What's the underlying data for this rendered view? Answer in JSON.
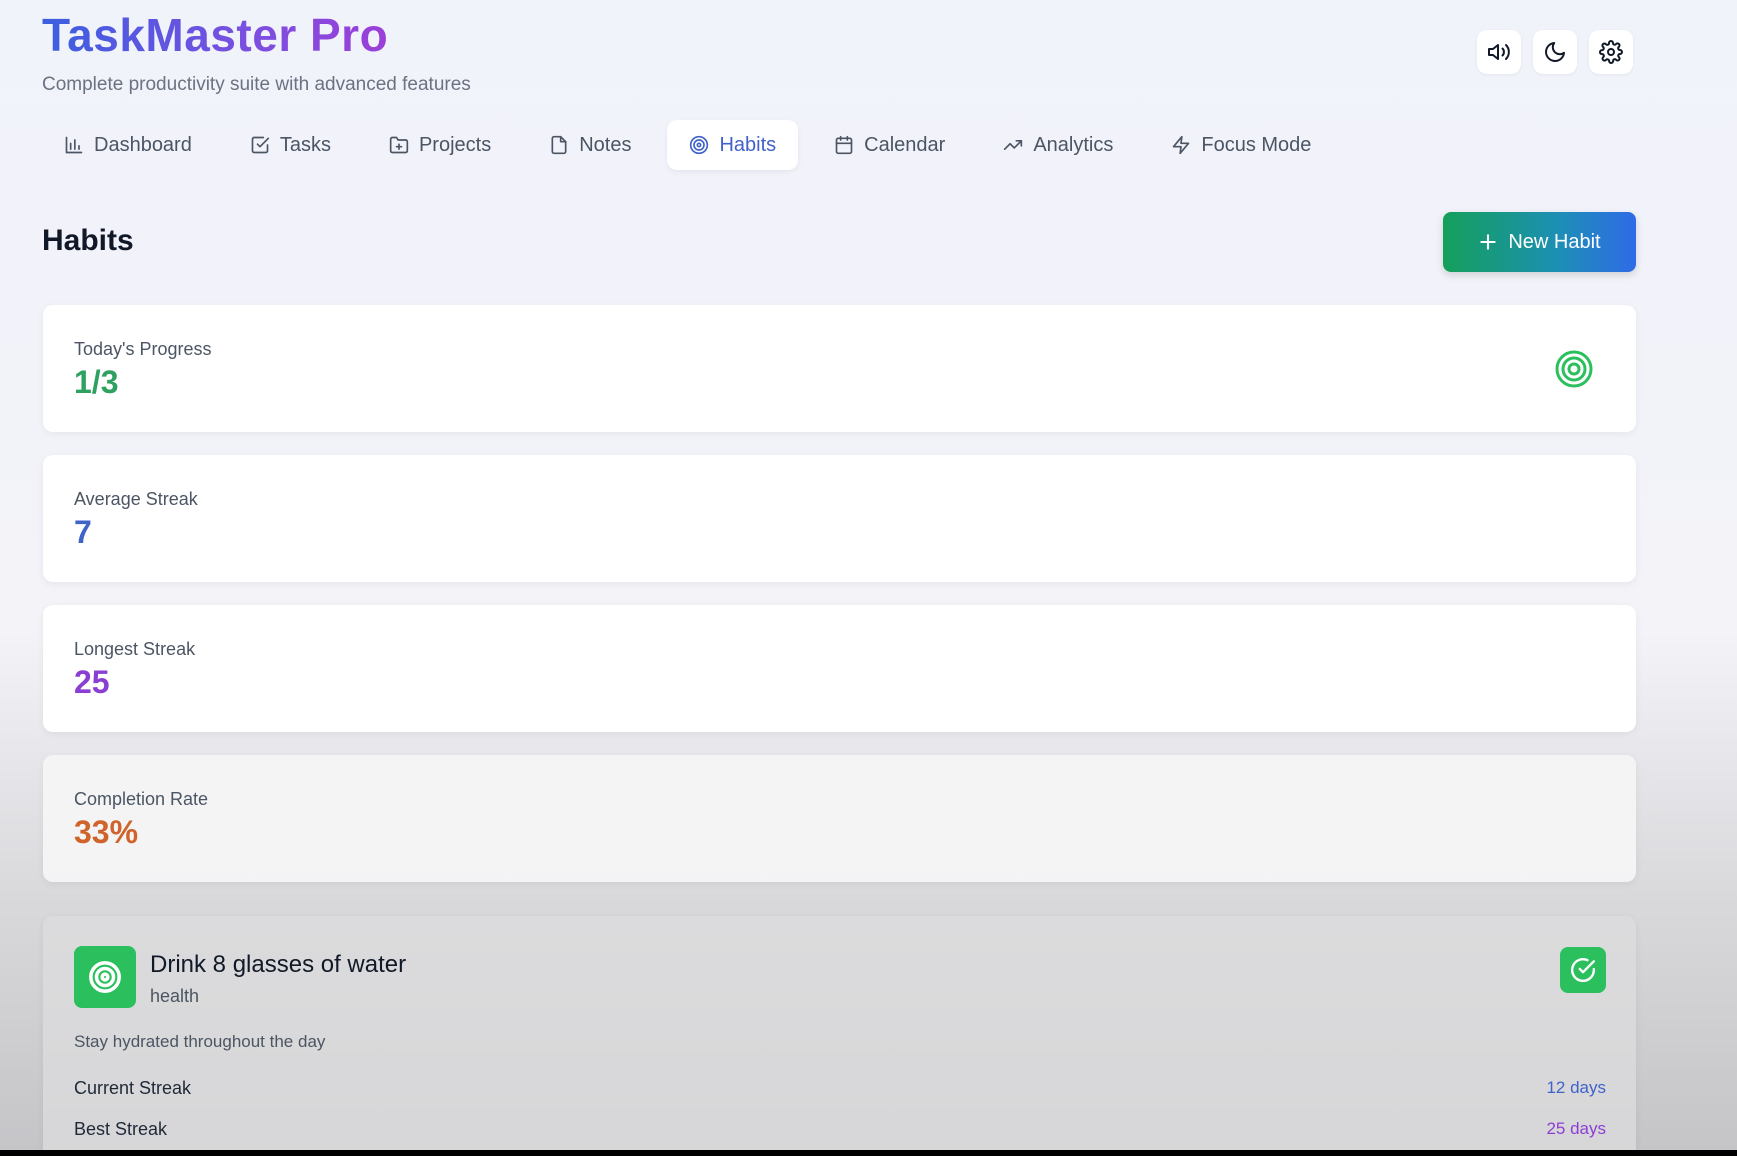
{
  "app": {
    "title": "TaskMaster Pro",
    "subtitle": "Complete productivity suite with advanced features"
  },
  "top_actions": [
    {
      "name": "sound-toggle-button",
      "icon": "volume-icon"
    },
    {
      "name": "dark-mode-button",
      "icon": "moon-icon"
    },
    {
      "name": "settings-button",
      "icon": "gear-icon"
    }
  ],
  "nav": {
    "items": [
      {
        "label": "Dashboard",
        "icon": "bar-chart-icon"
      },
      {
        "label": "Tasks",
        "icon": "checkbox-icon"
      },
      {
        "label": "Projects",
        "icon": "folder-icon"
      },
      {
        "label": "Notes",
        "icon": "file-icon"
      },
      {
        "label": "Habits",
        "icon": "target-icon",
        "active": true
      },
      {
        "label": "Calendar",
        "icon": "calendar-icon"
      },
      {
        "label": "Analytics",
        "icon": "trending-up-icon"
      },
      {
        "label": "Focus Mode",
        "icon": "lightning-icon"
      }
    ]
  },
  "page": {
    "title": "Habits",
    "new_button_label": "New Habit"
  },
  "stats": [
    {
      "label": "Today's Progress",
      "value": "1/3",
      "color": "#2ea160"
    },
    {
      "label": "Average Streak",
      "value": "7",
      "color": "#3f63c9"
    },
    {
      "label": "Longest Streak",
      "value": "25",
      "color": "#8b3fd2"
    },
    {
      "label": "Completion Rate",
      "value": "33%",
      "color": "#d0632a"
    }
  ],
  "habit": {
    "name": "Drink 8 glasses of water",
    "category": "health",
    "description": "Stay hydrated throughout the day",
    "current_streak_label": "Current Streak",
    "current_streak_value": "12 days",
    "best_streak_label": "Best Streak",
    "best_streak_value": "25 days",
    "accent": "#2bbf5e"
  },
  "colors": {
    "accent_blue": "#4262c9",
    "success_green": "#2bbf5e"
  }
}
